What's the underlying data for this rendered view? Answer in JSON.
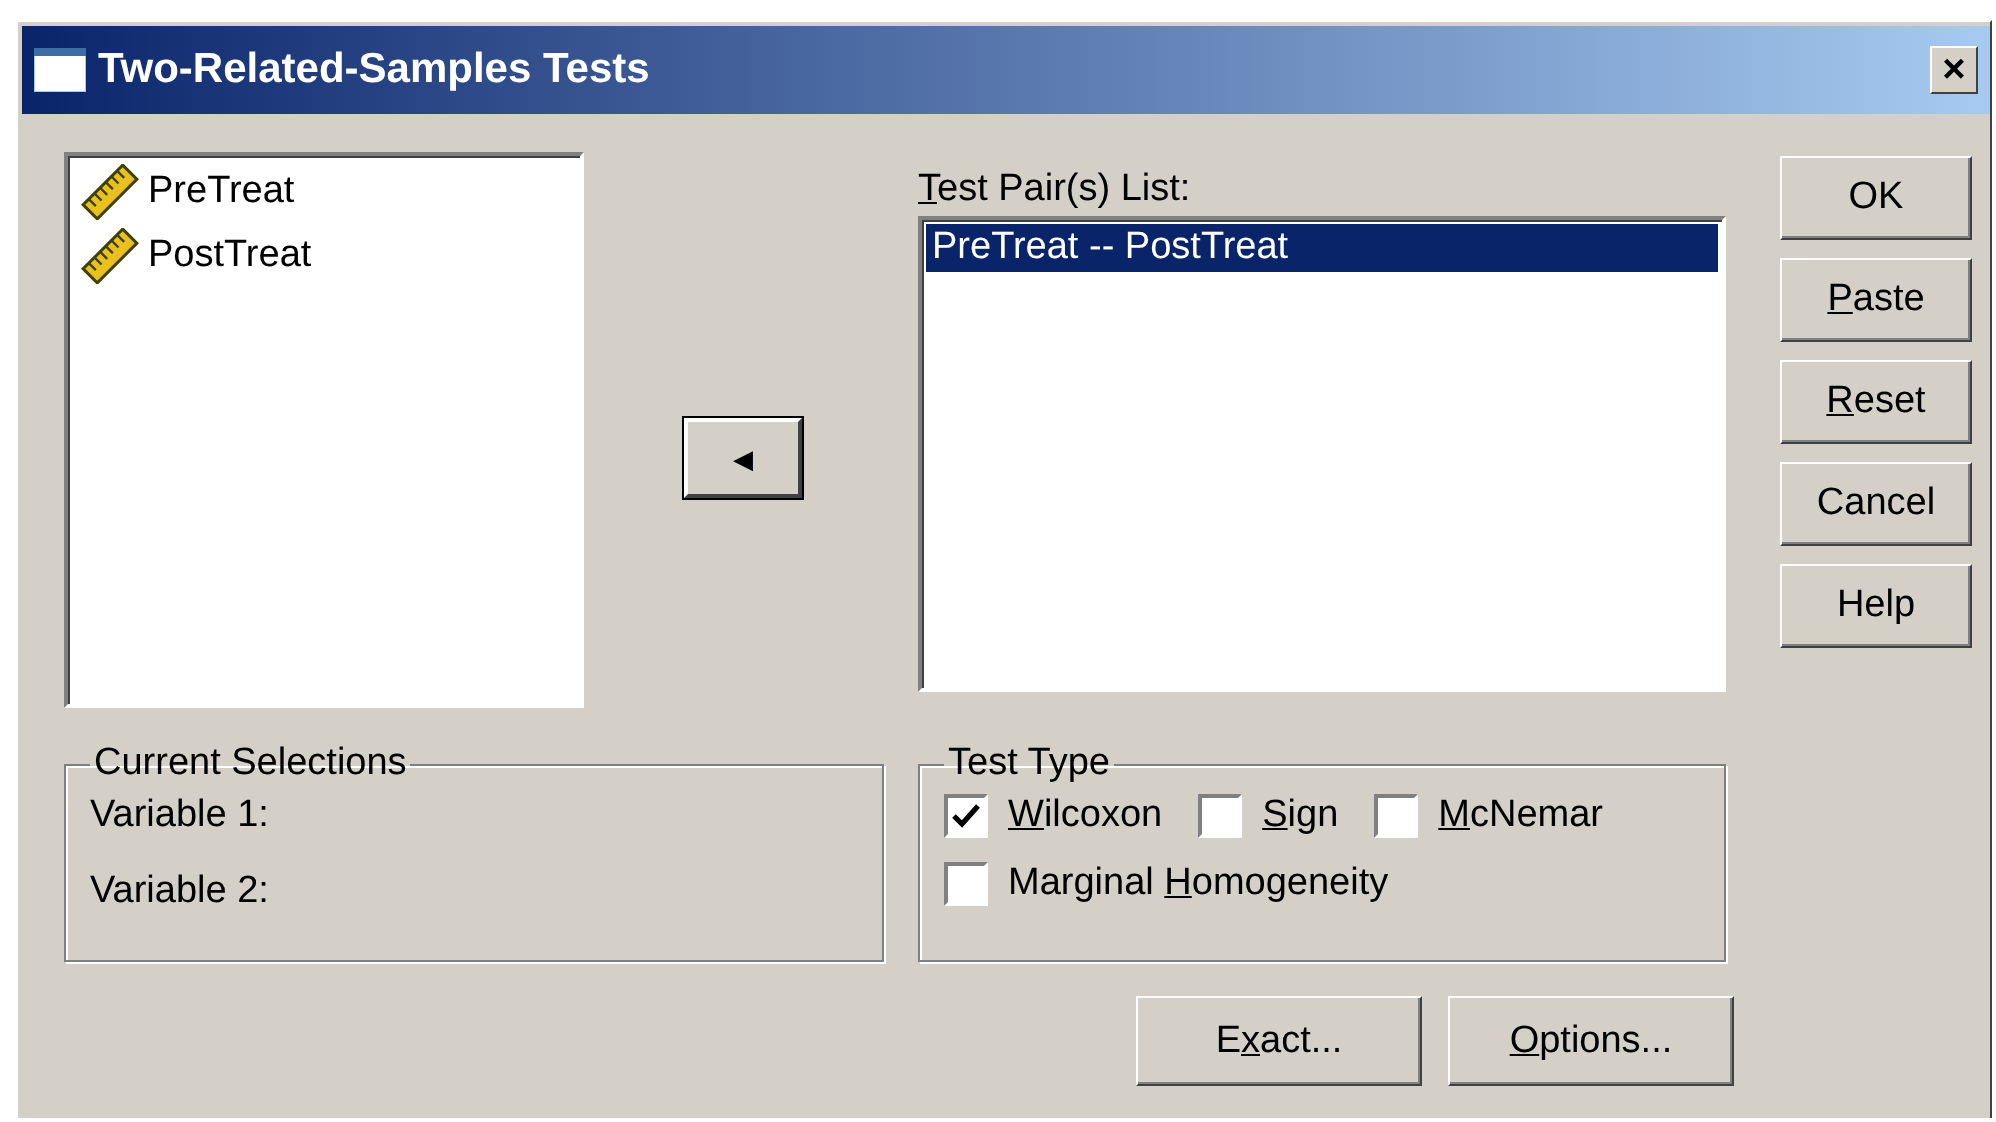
{
  "window": {
    "title": "Two-Related-Samples Tests",
    "close": "×"
  },
  "variables": [
    {
      "name": "PreTreat"
    },
    {
      "name": "PostTreat"
    }
  ],
  "move_button": {
    "glyph": "◀"
  },
  "pairs_label": {
    "key": "T",
    "post": "est Pair(s) List:"
  },
  "pairs": [
    {
      "text": "PreTreat -- PostTreat",
      "selected": true
    }
  ],
  "buttons": [
    {
      "post": "OK"
    },
    {
      "key": "P",
      "post": "aste"
    },
    {
      "key": "R",
      "post": "eset"
    },
    {
      "post": "Cancel"
    },
    {
      "post": "Help"
    }
  ],
  "current_selections": {
    "title": "Current Selections",
    "rows": [
      "Variable 1:",
      "Variable 2:"
    ]
  },
  "test_type": {
    "title": "Test Type",
    "options": [
      {
        "key": "W",
        "post": "ilcoxon",
        "checked": true
      },
      {
        "key": "S",
        "post": "ign",
        "checked": false
      },
      {
        "key": "M",
        "post": "cNemar",
        "checked": false
      },
      {
        "pre": "Marginal ",
        "key": "H",
        "post": "omogeneity",
        "checked": false
      }
    ]
  },
  "bottom_buttons": [
    {
      "pre": "E",
      "key": "x",
      "post": "act..."
    },
    {
      "key": "O",
      "post": "ptions..."
    }
  ]
}
